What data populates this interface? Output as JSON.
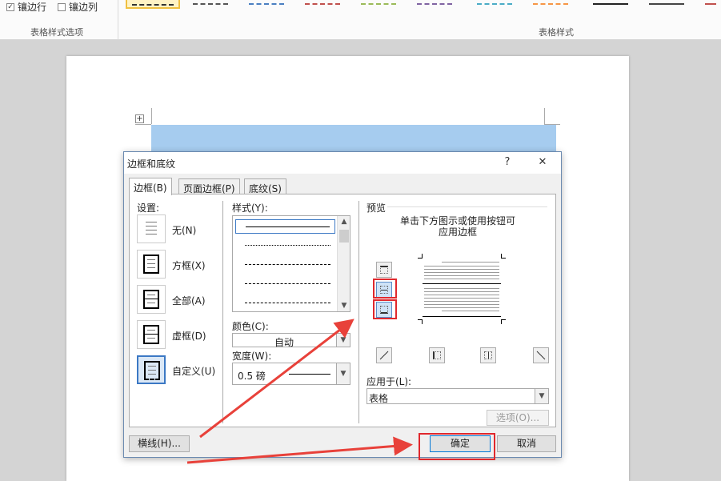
{
  "ribbon": {
    "banded_rows_label": "镶边行",
    "banded_cols_label": "镶边列",
    "group_options_label": "表格样式选项",
    "group_styles_label": "表格样式"
  },
  "dialog": {
    "title": "边框和底纹",
    "help_glyph": "?",
    "close_glyph": "✕",
    "tabs": [
      {
        "label": "边框(B)"
      },
      {
        "label": "页面边框(P)"
      },
      {
        "label": "底纹(S)"
      }
    ],
    "settings": {
      "label": "设置:",
      "items": [
        {
          "label": "无(N)"
        },
        {
          "label": "方框(X)"
        },
        {
          "label": "全部(A)"
        },
        {
          "label": "虚框(D)"
        },
        {
          "label": "自定义(U)"
        }
      ]
    },
    "style": {
      "label": "样式(Y):"
    },
    "color": {
      "label": "颜色(C):",
      "value": "自动"
    },
    "width": {
      "label": "宽度(W):",
      "value": "0.5 磅"
    },
    "preview": {
      "label": "预览",
      "hint_line1": "单击下方图示或使用按钮可",
      "hint_line2": "应用边框"
    },
    "apply_to": {
      "label": "应用于(L):",
      "value": "表格"
    },
    "options_label": "选项(O)...",
    "horizontal_line_label": "横线(H)...",
    "ok_label": "确定",
    "cancel_label": "取消"
  },
  "colors": {
    "selection_blue": "#a6ccef",
    "accent": "#3b78c4",
    "highlight_red": "#e0282d"
  }
}
